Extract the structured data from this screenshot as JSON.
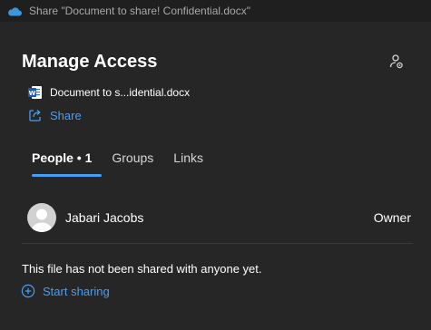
{
  "window": {
    "title": "Share \"Document to share! Confidential.docx\"",
    "app_icon": "onedrive-cloud-icon"
  },
  "header": {
    "title": "Manage Access",
    "settings_icon": "person-settings-icon"
  },
  "file": {
    "name": "Document to s...idential.docx",
    "icon": "word-document-icon"
  },
  "share": {
    "label": "Share",
    "icon": "share-icon"
  },
  "tabs": [
    {
      "label": "People • 1",
      "active": true
    },
    {
      "label": "Groups",
      "active": false
    },
    {
      "label": "Links",
      "active": false
    }
  ],
  "people": [
    {
      "name": "Jabari Jacobs",
      "role": "Owner"
    }
  ],
  "empty_message": "This file has not been shared with anyone yet.",
  "start_sharing": {
    "label": "Start sharing",
    "icon": "add-circle-icon"
  },
  "colors": {
    "background": "#262626",
    "accent": "#479ef5",
    "titlebar": "#1f1f1f"
  }
}
